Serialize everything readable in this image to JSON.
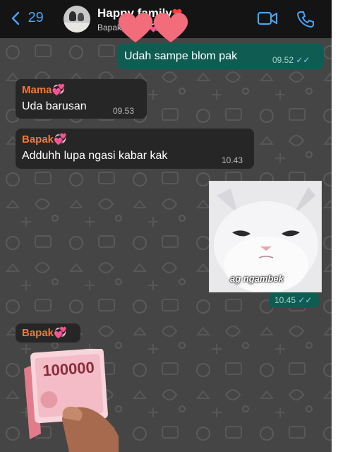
{
  "header": {
    "back_count": "29",
    "title": "Happy family",
    "subtitle": "Bapak, Mama💞, A..."
  },
  "messages": [
    {
      "direction": "out",
      "text": "Udah sampe blom pak",
      "time": "09.52",
      "read": true
    },
    {
      "direction": "in",
      "sender": "Mama💞",
      "text": "Uda barusan",
      "time": "09.53"
    },
    {
      "direction": "in",
      "sender": "Bapak💞",
      "text": "Adduhh lupa ngasi kabar kak",
      "time": "10.43"
    },
    {
      "direction": "out",
      "type": "sticker",
      "caption": "ag ngambek",
      "time": "10.45",
      "read": true
    },
    {
      "direction": "in",
      "sender": "Bapak💞",
      "type": "sticker",
      "banknote_value": "100000"
    }
  ],
  "colors": {
    "header_bg": "#141414",
    "accent_blue": "#4aa3f2",
    "outgoing_bubble": "#0f5c52",
    "incoming_bubble": "#262626",
    "sender_name": "#f07a3c",
    "wallpaper": "#454545"
  },
  "icons": [
    "chevron-left-icon",
    "video-call-icon",
    "phone-icon",
    "double-check-icon",
    "heart-sticker-icon"
  ]
}
